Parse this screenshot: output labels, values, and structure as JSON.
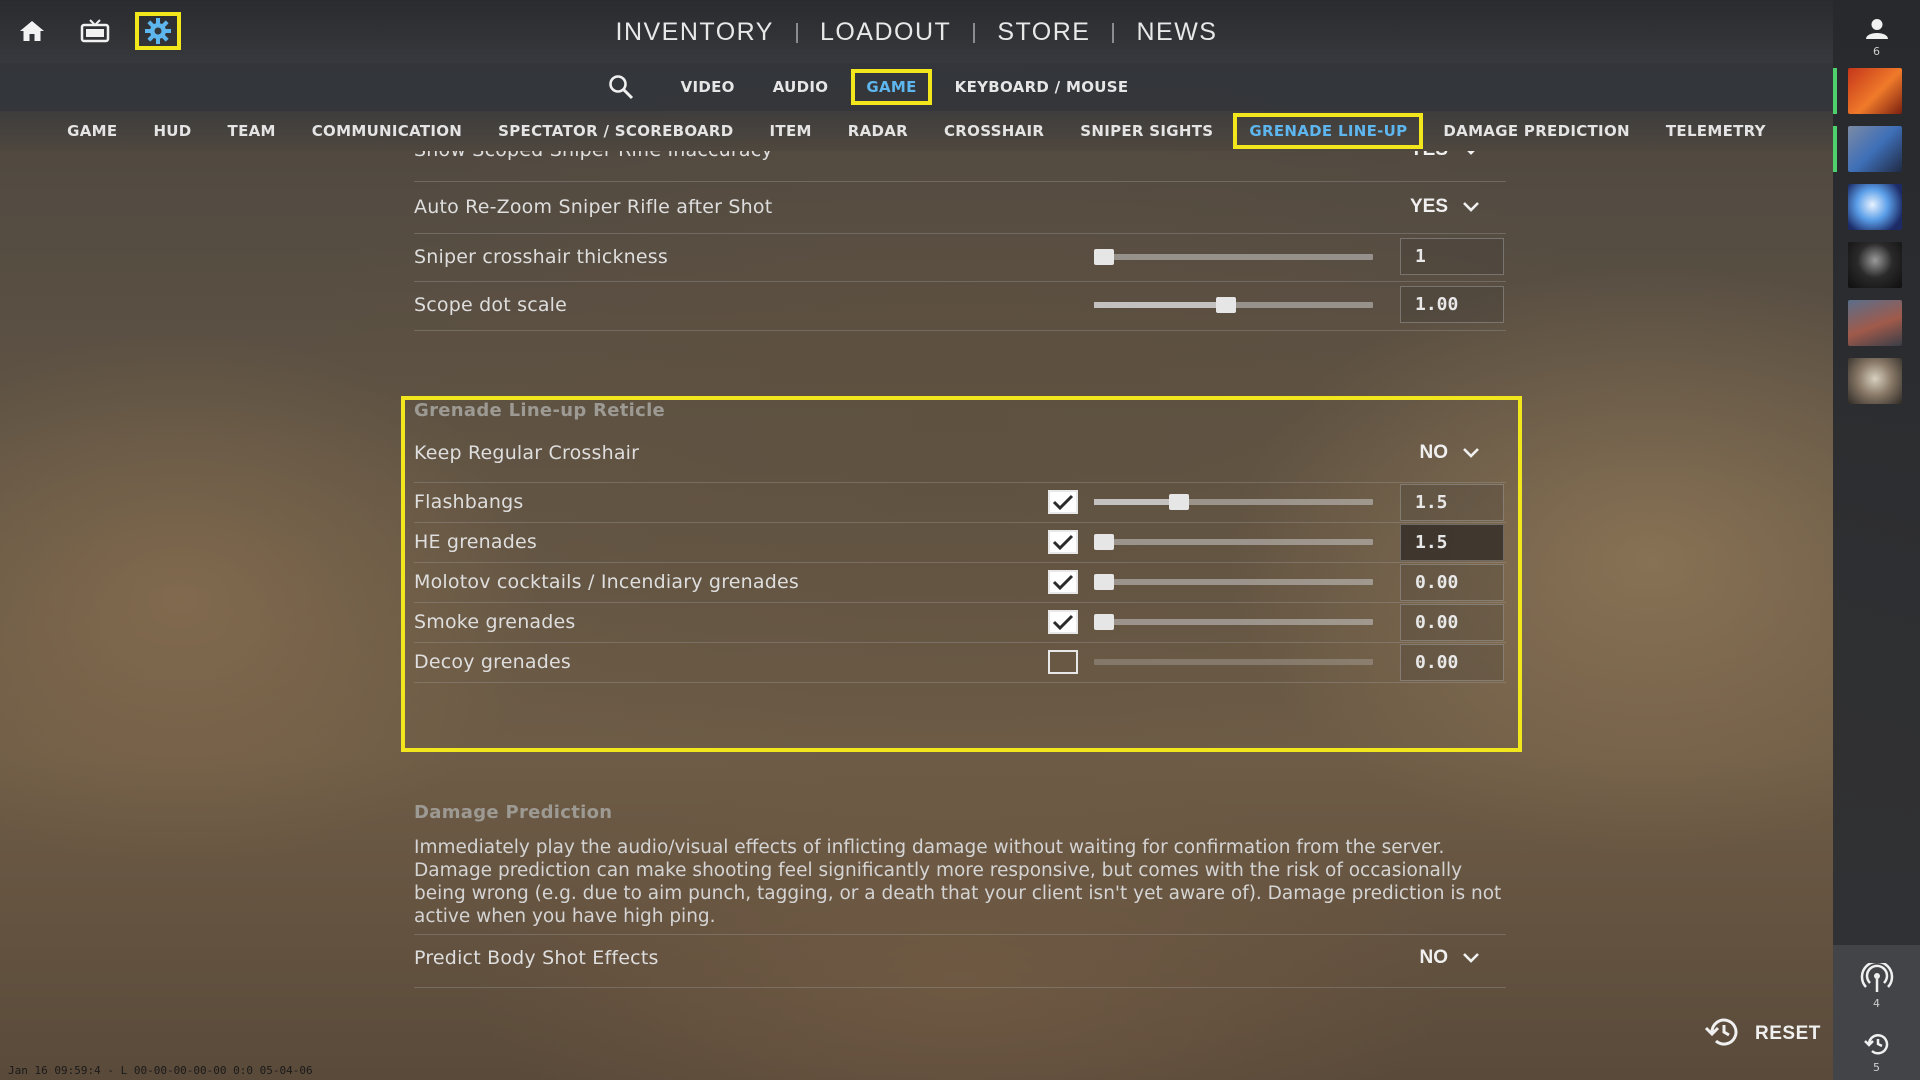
{
  "top_nav": {
    "items": [
      "INVENTORY",
      "LOADOUT",
      "STORE",
      "NEWS"
    ]
  },
  "settings_tabs": [
    "VIDEO",
    "AUDIO",
    "GAME",
    "KEYBOARD / MOUSE"
  ],
  "settings_active_tab": "GAME",
  "categories": [
    "GAME",
    "HUD",
    "TEAM",
    "COMMUNICATION",
    "SPECTATOR / SCOREBOARD",
    "ITEM",
    "RADAR",
    "CROSSHAIR",
    "SNIPER SIGHTS",
    "GRENADE LINE-UP",
    "DAMAGE PREDICTION",
    "TELEMETRY"
  ],
  "category_active": "GRENADE LINE-UP",
  "sidebar": {
    "friends_count": "6",
    "connections_count": "4",
    "history_count": "5"
  },
  "sniper": {
    "cut_row": {
      "label": "Show Scoped Sniper Rifle Inaccuracy",
      "value": "YES"
    },
    "auto_rezoom": {
      "label": "Auto Re-Zoom Sniper Rifle after Shot",
      "value": "YES"
    },
    "crosshair_thickness": {
      "label": "Sniper crosshair thickness",
      "value": "1",
      "level": 0.0
    },
    "scope_dot_scale": {
      "label": "Scope dot scale",
      "value": "1.00",
      "level": 0.47
    }
  },
  "grenade": {
    "title": "Grenade Line-up Reticle",
    "keep_crosshair": {
      "label": "Keep Regular Crosshair",
      "value": "NO"
    },
    "rows": [
      {
        "label": "Flashbangs",
        "checked": true,
        "value": "1.5",
        "level": 0.29
      },
      {
        "label": "HE grenades",
        "checked": true,
        "value": "1.5",
        "level": 0.0
      },
      {
        "label": "Molotov cocktails / Incendiary grenades",
        "checked": true,
        "value": "0.00",
        "level": 0.0
      },
      {
        "label": "Smoke grenades",
        "checked": true,
        "value": "0.00",
        "level": 0.0
      },
      {
        "label": "Decoy grenades",
        "checked": false,
        "value": "0.00",
        "level": 0.0
      }
    ]
  },
  "damage": {
    "title": "Damage Prediction",
    "description": "Immediately play the audio/visual effects of inflicting damage without waiting for confirmation from the server. Damage prediction can make shooting feel significantly more responsive, but comes with the risk of occasionally being wrong (e.g. due to aim punch, tagging, or a death that your client isn't yet aware of). Damage prediction is not active when you have high ping.",
    "body_shot": {
      "label": "Predict Body Shot Effects",
      "value": "NO"
    }
  },
  "reset_label": "RESET",
  "timestamp": "Jan 16 09:59:4 - L 00-00-00-00-00 0:0 05-04-06",
  "colors": {
    "accent": "#5eb6ef",
    "highlight": "#f2e71c"
  },
  "icons": {
    "home": "home-icon",
    "tv": "tv-icon",
    "settings": "gear-icon",
    "search": "search-icon",
    "user": "user-icon",
    "chevron": "chevron-down-icon",
    "check": "check-icon",
    "broadcast": "broadcast-icon",
    "history": "history-icon"
  }
}
